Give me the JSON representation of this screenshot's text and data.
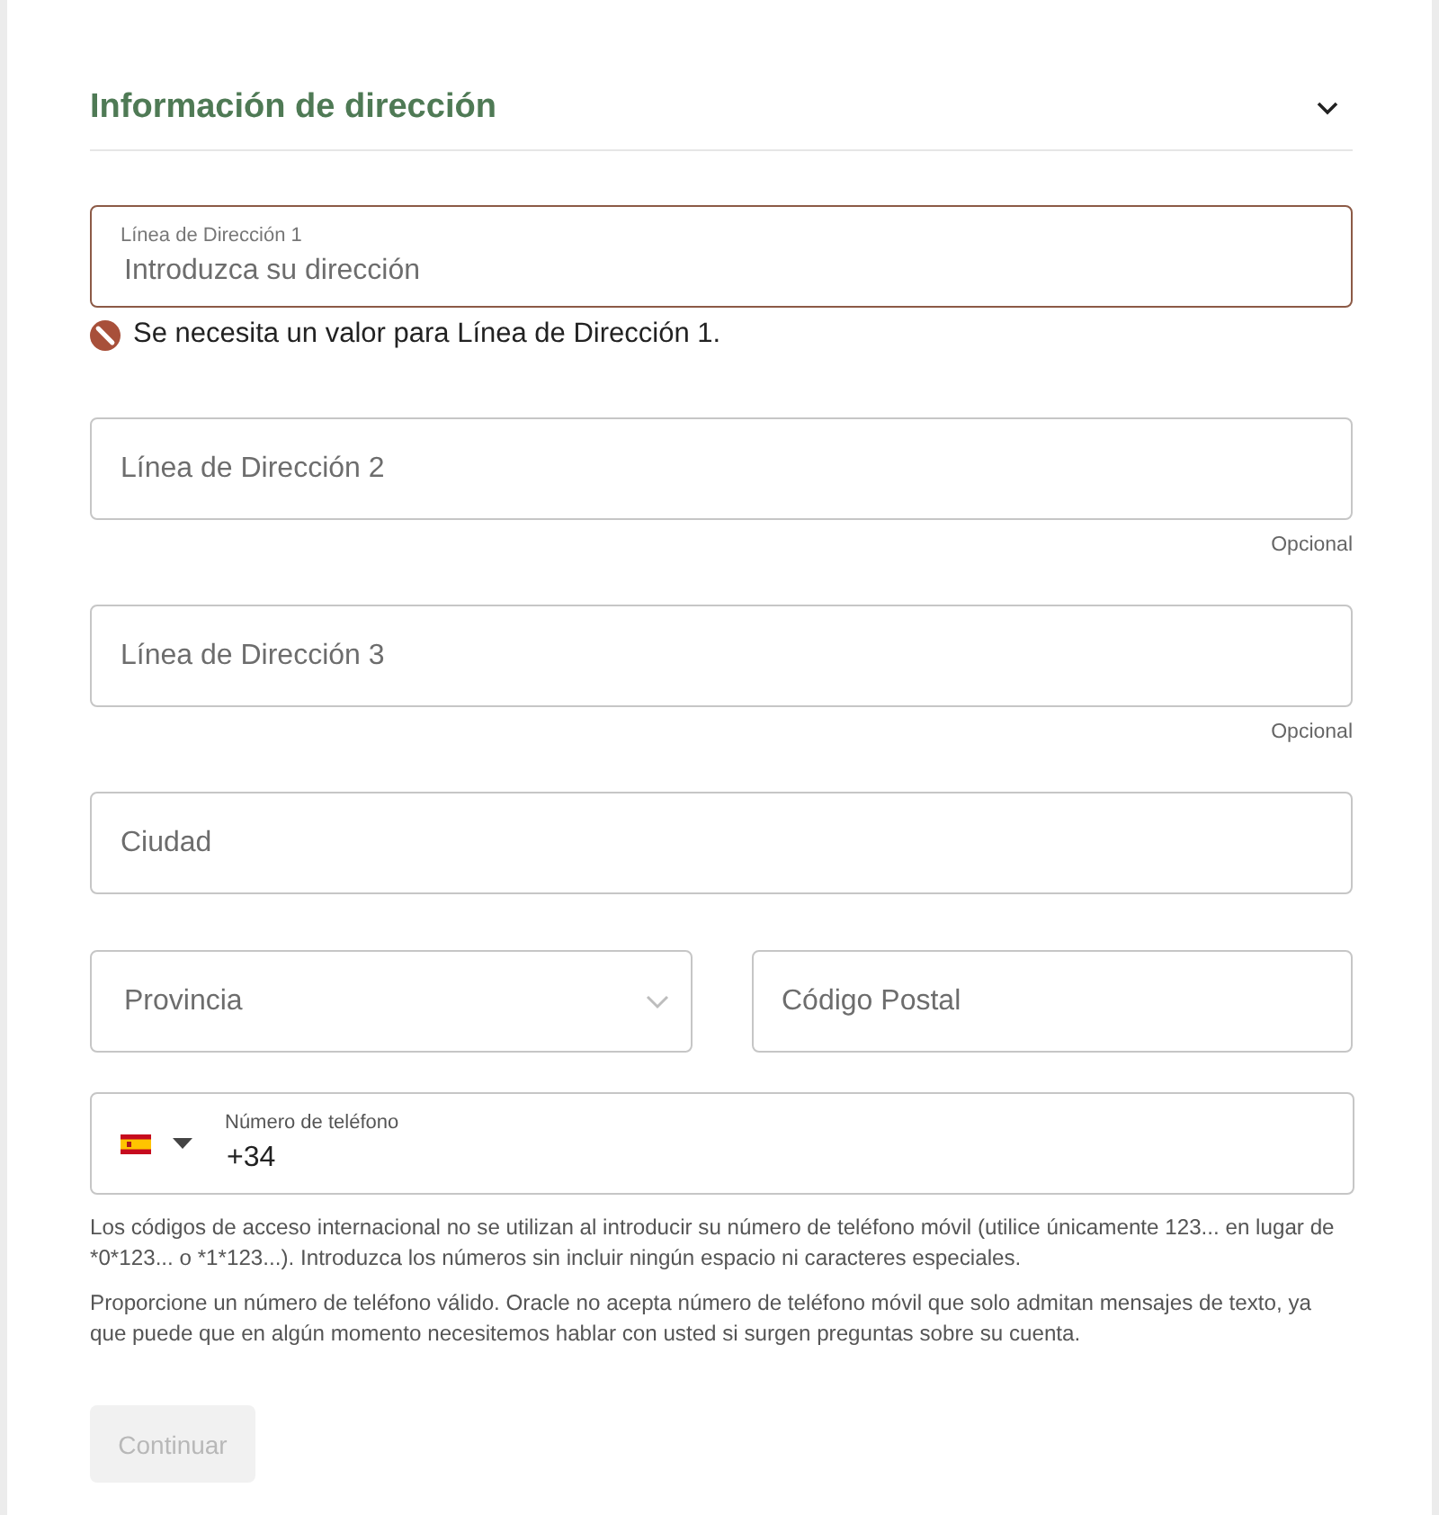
{
  "section": {
    "title": "Información de dirección",
    "expanded": true
  },
  "address_fields": [
    {
      "label": "Línea de Dirección 1",
      "placeholder": "Introduzca su dirección",
      "error": "Se necesita un valor para Línea de Dirección 1."
    },
    {
      "placeholder": "Línea de Dirección 2",
      "hint": "Opcional"
    },
    {
      "placeholder": "Línea de Dirección 3",
      "hint": "Opcional"
    },
    {
      "placeholder": "Ciudad"
    }
  ],
  "location_row": [
    {
      "kind": "select",
      "placeholder": "Provincia"
    },
    {
      "kind": "text",
      "placeholder": "Código Postal"
    }
  ],
  "phone": {
    "label": "Número de teléfono",
    "value": "+34"
  },
  "help_texts": [
    "Los códigos de acceso internacional no se utilizan al introducir su número de teléfono móvil (utilice únicamente 123... en lugar de *0*123... o *1*123...). Introduzca los números sin incluir ningún espacio ni caracteres especiales.",
    "Proporcione un número de teléfono válido. Oracle no acepta número de teléfono móvil que solo admitan mensajes de texto, ya que puede que en algún momento necesitemos hablar con usted si surgen preguntas sobre su cuenta."
  ],
  "submit_button": {
    "label": "Continuar",
    "disabled": true
  }
}
